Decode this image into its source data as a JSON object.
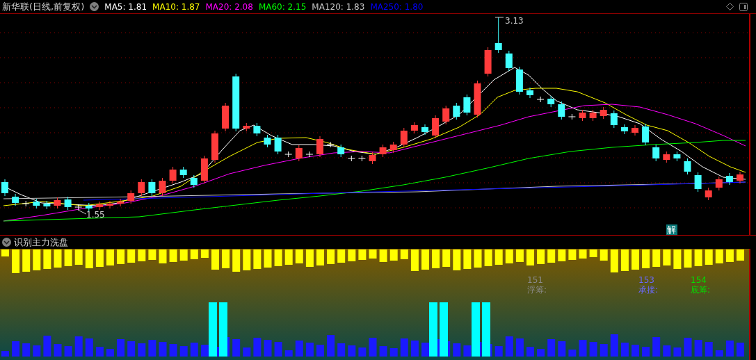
{
  "chart_header": {
    "title": "新华联(日线,前复权)",
    "indicators": [
      {
        "label": "MA5: 1.81",
        "color": "#ffffff"
      },
      {
        "label": "MA10: 1.87",
        "color": "#ffff00"
      },
      {
        "label": "MA20: 2.08",
        "color": "#ff00ff"
      },
      {
        "label": "MA60: 2.15",
        "color": "#00ff00"
      },
      {
        "label": "MA120: 1.83",
        "color": "#c8c8c8"
      },
      {
        "label": "MA250: 1.80",
        "color": "#0000ff"
      }
    ]
  },
  "price_chart": {
    "high_label": "3.13",
    "low_label": "1.55",
    "badge": "解"
  },
  "indicator_panel": {
    "title": "识别主力洗盘",
    "signals": [
      {
        "number": "151",
        "label": "浮筹:",
        "color": "#8a8a8a"
      },
      {
        "number": "153",
        "label": "承接:",
        "color": "#6a6aff"
      },
      {
        "number": "154",
        "label": "底筹:",
        "color": "#00e000"
      }
    ]
  }
}
